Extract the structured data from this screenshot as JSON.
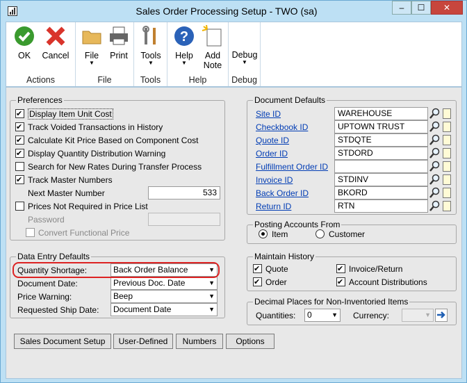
{
  "window": {
    "title": "Sales Order Processing Setup  -  TWO (sa)",
    "min": "–",
    "max": "☐",
    "close": "✕"
  },
  "ribbon": {
    "groups": {
      "actions": "Actions",
      "file": "File",
      "tools": "Tools",
      "help": "Help",
      "debug": "Debug"
    },
    "buttons": {
      "ok": "OK",
      "cancel": "Cancel",
      "file": "File",
      "print": "Print",
      "tools": "Tools",
      "help": "Help",
      "add_note_1": "Add",
      "add_note_2": "Note",
      "debug": "Debug"
    }
  },
  "preferences": {
    "title": "Preferences",
    "items": [
      {
        "label": "Display Item Unit Cost",
        "checked": true
      },
      {
        "label": "Track Voided Transactions in History",
        "checked": true
      },
      {
        "label": "Calculate Kit Price Based on Component Cost",
        "checked": true
      },
      {
        "label": "Display Quantity Distribution Warning",
        "checked": true
      },
      {
        "label": "Search for New Rates During Transfer Process",
        "checked": false
      },
      {
        "label": "Track Master Numbers",
        "checked": true
      }
    ],
    "next_master_label": "Next Master Number",
    "next_master_value": "533",
    "prices_not_required": "Prices Not Required in Price List",
    "password_label": "Password",
    "convert_functional": "Convert Functional Price"
  },
  "doc_defaults": {
    "title": "Document Defaults",
    "rows": [
      {
        "label": "Site ID",
        "value": "WAREHOUSE"
      },
      {
        "label": "Checkbook ID",
        "value": "UPTOWN TRUST"
      },
      {
        "label": "Quote ID",
        "value": "STDQTE"
      },
      {
        "label": "Order ID",
        "value": "STDORD"
      },
      {
        "label": "Fulfillment Order ID",
        "value": ""
      },
      {
        "label": "Invoice ID",
        "value": "STDINV"
      },
      {
        "label": "Back Order ID",
        "value": "BKORD"
      },
      {
        "label": "Return ID",
        "value": "RTN"
      }
    ]
  },
  "posting": {
    "title": "Posting Accounts From",
    "item": "Item",
    "customer": "Customer",
    "selected": "Item"
  },
  "data_entry": {
    "title": "Data Entry Defaults",
    "rows": [
      {
        "label": "Quantity Shortage:",
        "value": "Back Order Balance"
      },
      {
        "label": "Document Date:",
        "value": "Previous Doc. Date"
      },
      {
        "label": "Price Warning:",
        "value": "Beep"
      },
      {
        "label": "Requested Ship Date:",
        "value": "Document Date"
      }
    ]
  },
  "history": {
    "title": "Maintain History",
    "quote": "Quote",
    "order": "Order",
    "invoice_return": "Invoice/Return",
    "account_dist": "Account Distributions"
  },
  "decimal": {
    "title": "Decimal Places for Non-Inventoried Items",
    "quantities_label": "Quantities:",
    "quantities_value": "0",
    "currency_label": "Currency:",
    "currency_value": ""
  },
  "buttons": {
    "sales_doc_setup": "Sales Document Setup",
    "user_defined": "User-Defined",
    "numbers": "Numbers",
    "options": "Options"
  },
  "colors": {
    "accent_highlight": "#d22222",
    "link": "#003cb4",
    "ok_green": "#3a9a2e",
    "cancel_red": "#d9342b",
    "help_blue": "#2b62b8"
  }
}
